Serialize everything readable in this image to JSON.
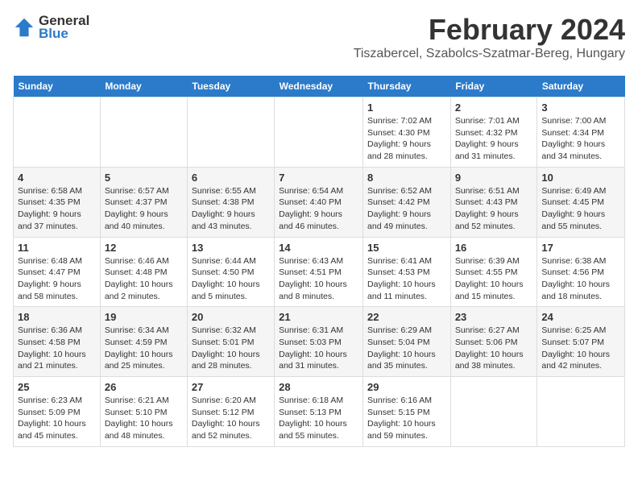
{
  "header": {
    "logo_line1": "General",
    "logo_line2": "Blue",
    "main_title": "February 2024",
    "sub_title": "Tiszabercel, Szabolcs-Szatmar-Bereg, Hungary"
  },
  "columns": [
    "Sunday",
    "Monday",
    "Tuesday",
    "Wednesday",
    "Thursday",
    "Friday",
    "Saturday"
  ],
  "weeks": [
    [
      {
        "day": "",
        "info": ""
      },
      {
        "day": "",
        "info": ""
      },
      {
        "day": "",
        "info": ""
      },
      {
        "day": "",
        "info": ""
      },
      {
        "day": "1",
        "info": "Sunrise: 7:02 AM\nSunset: 4:30 PM\nDaylight: 9 hours\nand 28 minutes."
      },
      {
        "day": "2",
        "info": "Sunrise: 7:01 AM\nSunset: 4:32 PM\nDaylight: 9 hours\nand 31 minutes."
      },
      {
        "day": "3",
        "info": "Sunrise: 7:00 AM\nSunset: 4:34 PM\nDaylight: 9 hours\nand 34 minutes."
      }
    ],
    [
      {
        "day": "4",
        "info": "Sunrise: 6:58 AM\nSunset: 4:35 PM\nDaylight: 9 hours\nand 37 minutes."
      },
      {
        "day": "5",
        "info": "Sunrise: 6:57 AM\nSunset: 4:37 PM\nDaylight: 9 hours\nand 40 minutes."
      },
      {
        "day": "6",
        "info": "Sunrise: 6:55 AM\nSunset: 4:38 PM\nDaylight: 9 hours\nand 43 minutes."
      },
      {
        "day": "7",
        "info": "Sunrise: 6:54 AM\nSunset: 4:40 PM\nDaylight: 9 hours\nand 46 minutes."
      },
      {
        "day": "8",
        "info": "Sunrise: 6:52 AM\nSunset: 4:42 PM\nDaylight: 9 hours\nand 49 minutes."
      },
      {
        "day": "9",
        "info": "Sunrise: 6:51 AM\nSunset: 4:43 PM\nDaylight: 9 hours\nand 52 minutes."
      },
      {
        "day": "10",
        "info": "Sunrise: 6:49 AM\nSunset: 4:45 PM\nDaylight: 9 hours\nand 55 minutes."
      }
    ],
    [
      {
        "day": "11",
        "info": "Sunrise: 6:48 AM\nSunset: 4:47 PM\nDaylight: 9 hours\nand 58 minutes."
      },
      {
        "day": "12",
        "info": "Sunrise: 6:46 AM\nSunset: 4:48 PM\nDaylight: 10 hours\nand 2 minutes."
      },
      {
        "day": "13",
        "info": "Sunrise: 6:44 AM\nSunset: 4:50 PM\nDaylight: 10 hours\nand 5 minutes."
      },
      {
        "day": "14",
        "info": "Sunrise: 6:43 AM\nSunset: 4:51 PM\nDaylight: 10 hours\nand 8 minutes."
      },
      {
        "day": "15",
        "info": "Sunrise: 6:41 AM\nSunset: 4:53 PM\nDaylight: 10 hours\nand 11 minutes."
      },
      {
        "day": "16",
        "info": "Sunrise: 6:39 AM\nSunset: 4:55 PM\nDaylight: 10 hours\nand 15 minutes."
      },
      {
        "day": "17",
        "info": "Sunrise: 6:38 AM\nSunset: 4:56 PM\nDaylight: 10 hours\nand 18 minutes."
      }
    ],
    [
      {
        "day": "18",
        "info": "Sunrise: 6:36 AM\nSunset: 4:58 PM\nDaylight: 10 hours\nand 21 minutes."
      },
      {
        "day": "19",
        "info": "Sunrise: 6:34 AM\nSunset: 4:59 PM\nDaylight: 10 hours\nand 25 minutes."
      },
      {
        "day": "20",
        "info": "Sunrise: 6:32 AM\nSunset: 5:01 PM\nDaylight: 10 hours\nand 28 minutes."
      },
      {
        "day": "21",
        "info": "Sunrise: 6:31 AM\nSunset: 5:03 PM\nDaylight: 10 hours\nand 31 minutes."
      },
      {
        "day": "22",
        "info": "Sunrise: 6:29 AM\nSunset: 5:04 PM\nDaylight: 10 hours\nand 35 minutes."
      },
      {
        "day": "23",
        "info": "Sunrise: 6:27 AM\nSunset: 5:06 PM\nDaylight: 10 hours\nand 38 minutes."
      },
      {
        "day": "24",
        "info": "Sunrise: 6:25 AM\nSunset: 5:07 PM\nDaylight: 10 hours\nand 42 minutes."
      }
    ],
    [
      {
        "day": "25",
        "info": "Sunrise: 6:23 AM\nSunset: 5:09 PM\nDaylight: 10 hours\nand 45 minutes."
      },
      {
        "day": "26",
        "info": "Sunrise: 6:21 AM\nSunset: 5:10 PM\nDaylight: 10 hours\nand 48 minutes."
      },
      {
        "day": "27",
        "info": "Sunrise: 6:20 AM\nSunset: 5:12 PM\nDaylight: 10 hours\nand 52 minutes."
      },
      {
        "day": "28",
        "info": "Sunrise: 6:18 AM\nSunset: 5:13 PM\nDaylight: 10 hours\nand 55 minutes."
      },
      {
        "day": "29",
        "info": "Sunrise: 6:16 AM\nSunset: 5:15 PM\nDaylight: 10 hours\nand 59 minutes."
      },
      {
        "day": "",
        "info": ""
      },
      {
        "day": "",
        "info": ""
      }
    ]
  ]
}
